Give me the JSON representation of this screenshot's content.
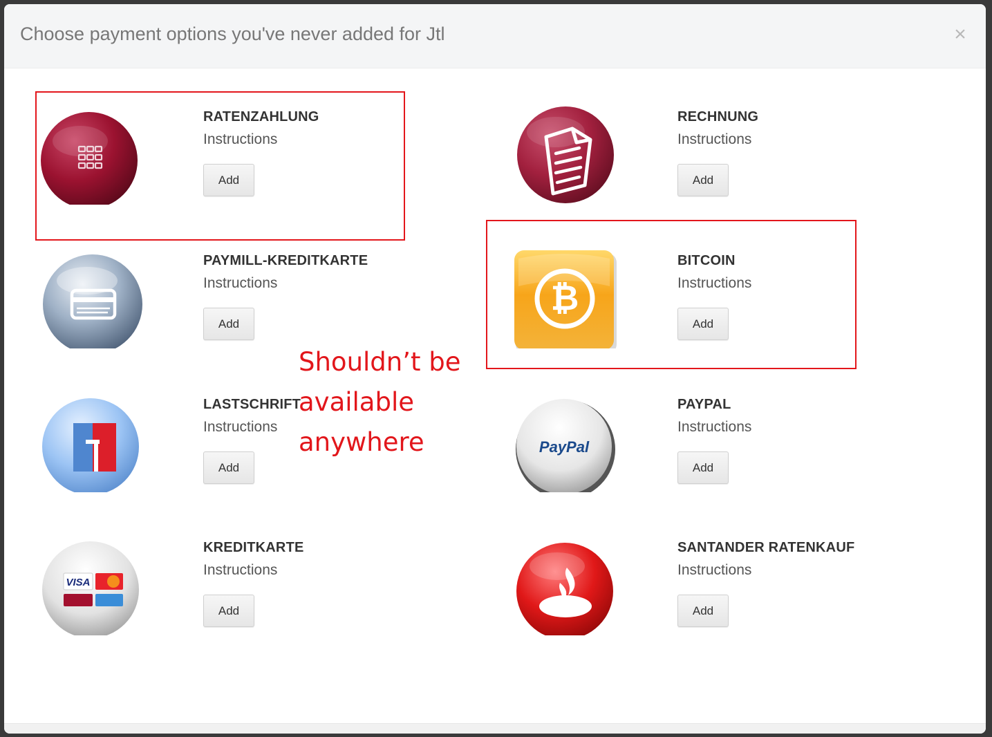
{
  "dialog": {
    "title": "Choose payment options you've never added for Jtl",
    "close_label": "×"
  },
  "options": [
    {
      "name": "RATENZAHLUNG",
      "instructions": "Instructions",
      "add_label": "Add",
      "icon": "grid-icon"
    },
    {
      "name": "RECHNUNG",
      "instructions": "Instructions",
      "add_label": "Add",
      "icon": "document-icon"
    },
    {
      "name": "PAYMILL-KREDITKARTE",
      "instructions": "Instructions",
      "add_label": "Add",
      "icon": "credit-card-icon"
    },
    {
      "name": "BITCOIN",
      "instructions": "Instructions",
      "add_label": "Add",
      "icon": "bitcoin-icon"
    },
    {
      "name": "LASTSCHRIFT",
      "instructions": "Instructions",
      "add_label": "Add",
      "icon": "ec-icon"
    },
    {
      "name": "PAYPAL",
      "instructions": "Instructions",
      "add_label": "Add",
      "icon": "paypal-icon",
      "logo_text": "PayPal"
    },
    {
      "name": "KREDITKARTE",
      "instructions": "Instructions",
      "add_label": "Add",
      "icon": "card-brands-icon",
      "logo_text": "VISA"
    },
    {
      "name": "SANTANDER RATENKAUF",
      "instructions": "Instructions",
      "add_label": "Add",
      "icon": "santander-flame-icon"
    }
  ],
  "annotation": {
    "lines": [
      "Shouldn’t be",
      "available",
      "anywhere"
    ],
    "color": "#e2161b"
  },
  "colors": {
    "highlight_border": "#e3161b",
    "maroon": "#9b1230",
    "bitcoin_orange": "#f7a51a",
    "santander_red": "#e01818"
  }
}
